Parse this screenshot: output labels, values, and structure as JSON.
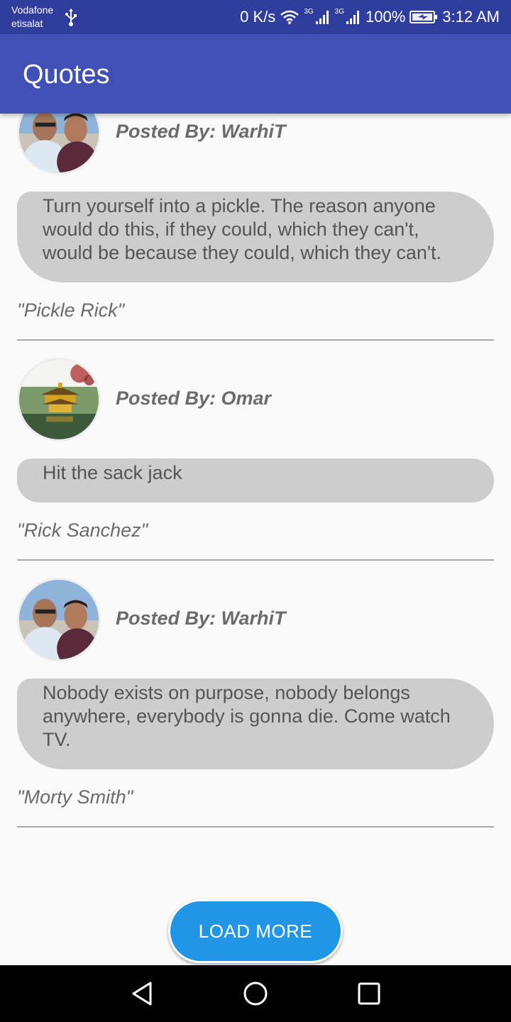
{
  "status_bar": {
    "carrier_1": "Vodafone",
    "carrier_2": "etisalat",
    "speed": "0 K/s",
    "net_1": "3G",
    "net_2": "3G",
    "battery": "100%",
    "time": "3:12 AM"
  },
  "app_bar": {
    "title": "Quotes"
  },
  "posts": [
    {
      "posted_by": "Posted By: WarhiT",
      "quote_lines": [
        "Turn yourself into a pickle. The reason anyone",
        "would do this, if they could, which they can't,",
        "would be because they could, which they can't."
      ],
      "author": "\"Pickle Rick\"",
      "avatar": "selfie-photo"
    },
    {
      "posted_by": "Posted By: Omar",
      "quote_lines": [
        "Hit the sack jack"
      ],
      "author": "\"Rick Sanchez\"",
      "avatar": "golden-pavilion-photo"
    },
    {
      "posted_by": "Posted By: WarhiT",
      "quote_lines": [
        "Nobody exists on purpose, nobody belongs",
        "anywhere, everybody is gonna die. Come watch",
        "TV."
      ],
      "author": "\"Morty Smith\"",
      "avatar": "selfie-photo"
    }
  ],
  "load_more_label": "LOAD MORE",
  "colors": {
    "app_bar": "#3f51b5",
    "status_bar": "#2f3d9e",
    "bubble": "#cdcdcd",
    "button": "#2196e6"
  },
  "nav_icons": [
    "back-icon",
    "home-icon",
    "recents-icon"
  ]
}
